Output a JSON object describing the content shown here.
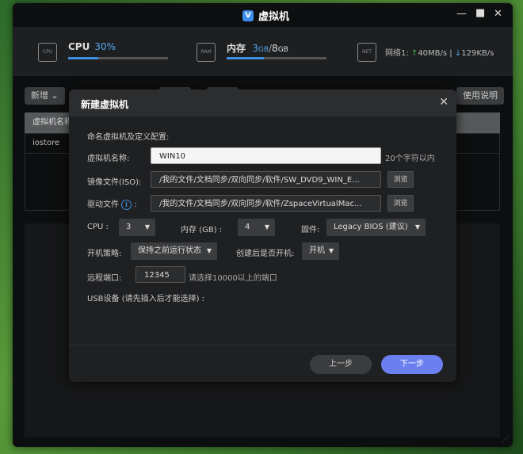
{
  "window": {
    "title": "虚拟机",
    "logo": "V"
  },
  "stats": {
    "cpu": {
      "label": "CPU",
      "value": "30%",
      "progress": 0.3
    },
    "memory": {
      "label": "内存",
      "used": "3",
      "used_unit": "GB",
      "separator": "/",
      "total": "8",
      "total_unit": "GB",
      "progress": 0.375
    },
    "network": {
      "label": "网络1:",
      "up_arrow": "↑",
      "up": "40MB/s",
      "sep": "|",
      "down_arrow": "↓",
      "down": "129KB/s"
    },
    "cpu_chip_text": "CPU",
    "mem_chip_text": "RAM",
    "net_chip_text": "NET"
  },
  "toolbar": {
    "new_label": "新增",
    "help_label": "使用说明"
  },
  "table": {
    "columns": [
      "虚拟机名称"
    ],
    "rows": [
      [
        "iostore"
      ]
    ]
  },
  "dialog": {
    "title": "新建虚拟机",
    "subtitle": "命名虚拟机及定义配置:",
    "name_label": "虚拟机名称:",
    "name_value": "WIN10",
    "name_hint": "20个字符以内",
    "iso_label": "镜像文件(ISO):",
    "iso_value": "/我的文件/文档同步/双向同步/软件/SW_DVD9_WIN_E...",
    "driver_label": "驱动文件",
    "driver_colon": ":",
    "driver_value": "/我的文件/文档同步/双向同步/软件/ZspaceVirtualMac...",
    "browse_label": "浏览",
    "cpu_label": "CPU :",
    "cpu_value": "3",
    "mem_label": "内存 (GB) :",
    "mem_value": "4",
    "firmware_label": "固件:",
    "firmware_value": "Legacy BIOS (建议)",
    "boot_label": "开机策略:",
    "boot_value": "保持之前运行状态",
    "autostart_label": "创建后是否开机:",
    "autostart_value": "开机",
    "port_label": "远程端口:",
    "port_value": "12345",
    "port_hint": "请选择10000以上的端口",
    "usb_label": "USB设备 (请先插入后才能选择) :",
    "prev_label": "上一步",
    "next_label": "下一步",
    "info_glyph": "i"
  },
  "colors": {
    "accent": "#6b7ff0",
    "cpu_value": "#56a7f0",
    "upload": "#4cba5a"
  }
}
